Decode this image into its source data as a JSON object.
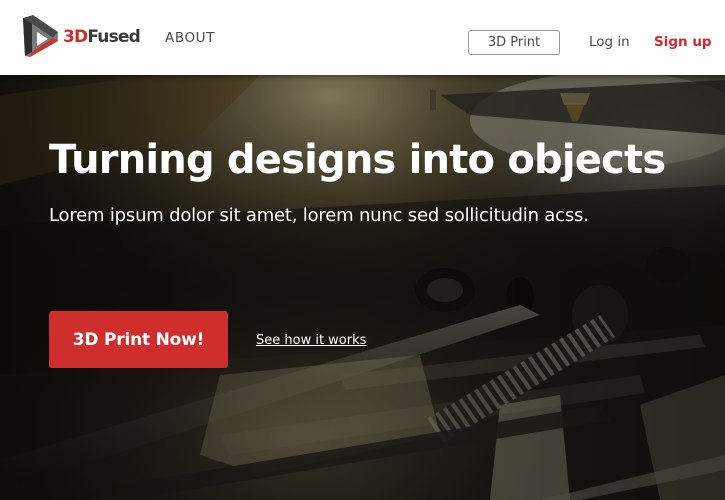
{
  "header": {
    "logo": {
      "text_prefix": "3D",
      "text_suffix": "Fused",
      "icon": "penrose-triangle-logo-icon"
    },
    "nav": {
      "about_label": "ABOUT",
      "print_button_label": "3D Print",
      "login_label": "Log in",
      "signup_label": "Sign up"
    }
  },
  "hero": {
    "title": "Turning designs into objects",
    "subtitle": "Lorem ipsum dolor sit amet, lorem nunc sed sollicitudin acss.",
    "cta_label": "3D Print Now!",
    "secondary_link_label": "See how it works",
    "background": "dark-3d-printer-photo"
  },
  "colors": {
    "brand_red": "#cf2f2c",
    "header_bg": "#ffffff",
    "nav_text": "#4a4a4a",
    "hero_text": "#ffffff"
  }
}
